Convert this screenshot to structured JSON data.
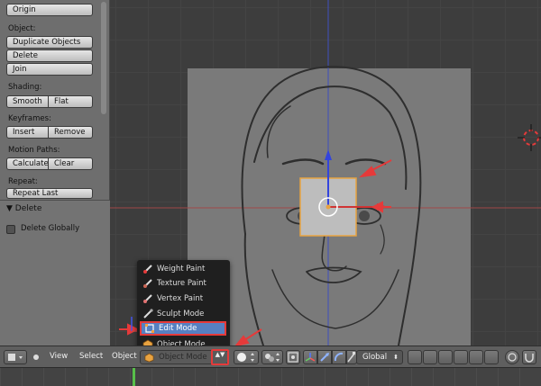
{
  "toolshelf": {
    "origin_label": "Origin",
    "object_section": "Object:",
    "duplicate_label": "Duplicate Objects",
    "delete_label": "Delete",
    "join_label": "Join",
    "shading_section": "Shading:",
    "smooth_label": "Smooth",
    "flat_label": "Flat",
    "keyframes_section": "Keyframes:",
    "insert_label": "Insert",
    "remove_label": "Remove",
    "motion_section": "Motion Paths:",
    "calculate_label": "Calculate",
    "clear_label": "Clear",
    "repeat_section": "Repeat:",
    "repeat_last_label": "Repeat Last"
  },
  "operator_panel": {
    "title": "Delete",
    "collapse_glyph": "▼",
    "option_label": "Delete Globally",
    "option_checked": false
  },
  "mode_menu": {
    "items": [
      {
        "label": "Weight Paint",
        "icon": "weight-paint-icon",
        "selected": false
      },
      {
        "label": "Texture Paint",
        "icon": "texture-paint-icon",
        "selected": false
      },
      {
        "label": "Vertex Paint",
        "icon": "vertex-paint-icon",
        "selected": false
      },
      {
        "label": "Sculpt Mode",
        "icon": "sculpt-icon",
        "selected": false
      },
      {
        "label": "Edit Mode",
        "icon": "edit-mode-icon",
        "selected": true
      },
      {
        "label": "Object Mode",
        "icon": "object-mode-icon",
        "selected": false
      }
    ]
  },
  "header": {
    "view_label": "View",
    "select_label": "Select",
    "object_label": "Object",
    "mode_value": "Object Mode",
    "orientation_value": "Global",
    "arrows_glyph": "▲▼"
  },
  "colors": {
    "accent": "#5680c2",
    "highlight_red": "#e53a3a",
    "frame_cursor": "#58c04a",
    "selected_object": "#e8a341"
  }
}
